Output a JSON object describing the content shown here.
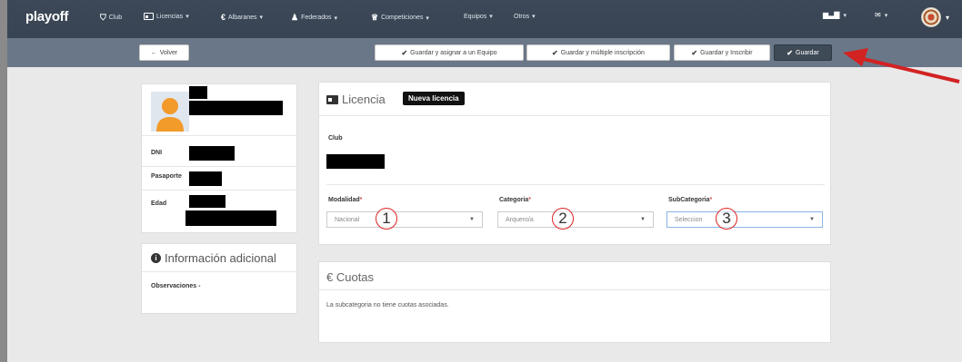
{
  "navbar": {
    "brand": "playoff",
    "items": [
      {
        "label": "Club",
        "icon": "shield-icon"
      },
      {
        "label": "Licencias",
        "icon": "id-card-icon"
      },
      {
        "label": "Albaranes",
        "icon": "euro-icon"
      },
      {
        "label": "Federados",
        "icon": "user-icon"
      },
      {
        "label": "Competiciones",
        "icon": "trophy-icon"
      },
      {
        "label": "Equipos"
      },
      {
        "label": "Otros"
      }
    ]
  },
  "toolbar": {
    "back_label": "Volver",
    "btn_equipo": "Guardar y asignar a un Equipo",
    "btn_multiple": "Guardar y múltiple inscripción",
    "btn_inscribir": "Guardar y Inscribir",
    "btn_guardar": "Guardar"
  },
  "profile": {
    "dni_label": "DNI",
    "pasaporte_label": "Pasaporte",
    "edad_label": "Edad"
  },
  "info": {
    "title": "Información adicional",
    "observaciones": "Observaciones -"
  },
  "licencia": {
    "title": "Licencia",
    "badge": "Nueva licencia",
    "club_label": "Club",
    "modalidad_label": "Modalidad",
    "modalidad_value": "Nacional",
    "categoria_label": "Categoria",
    "categoria_value": "Arquero/a",
    "subcategoria_label": "SubCategoria",
    "subcategoria_value": "Seleccion",
    "subcategoria_value_tail": "n",
    "required_mark": "*",
    "annotations": [
      "1",
      "2",
      "3"
    ]
  },
  "cuotas": {
    "title": "Cuotas",
    "message": "La subcategoria no tiene cuotas asociadas."
  },
  "colors": {
    "navbar": "#3e4b5b",
    "toolbar": "#6a7788",
    "annotation": "#d22222"
  }
}
